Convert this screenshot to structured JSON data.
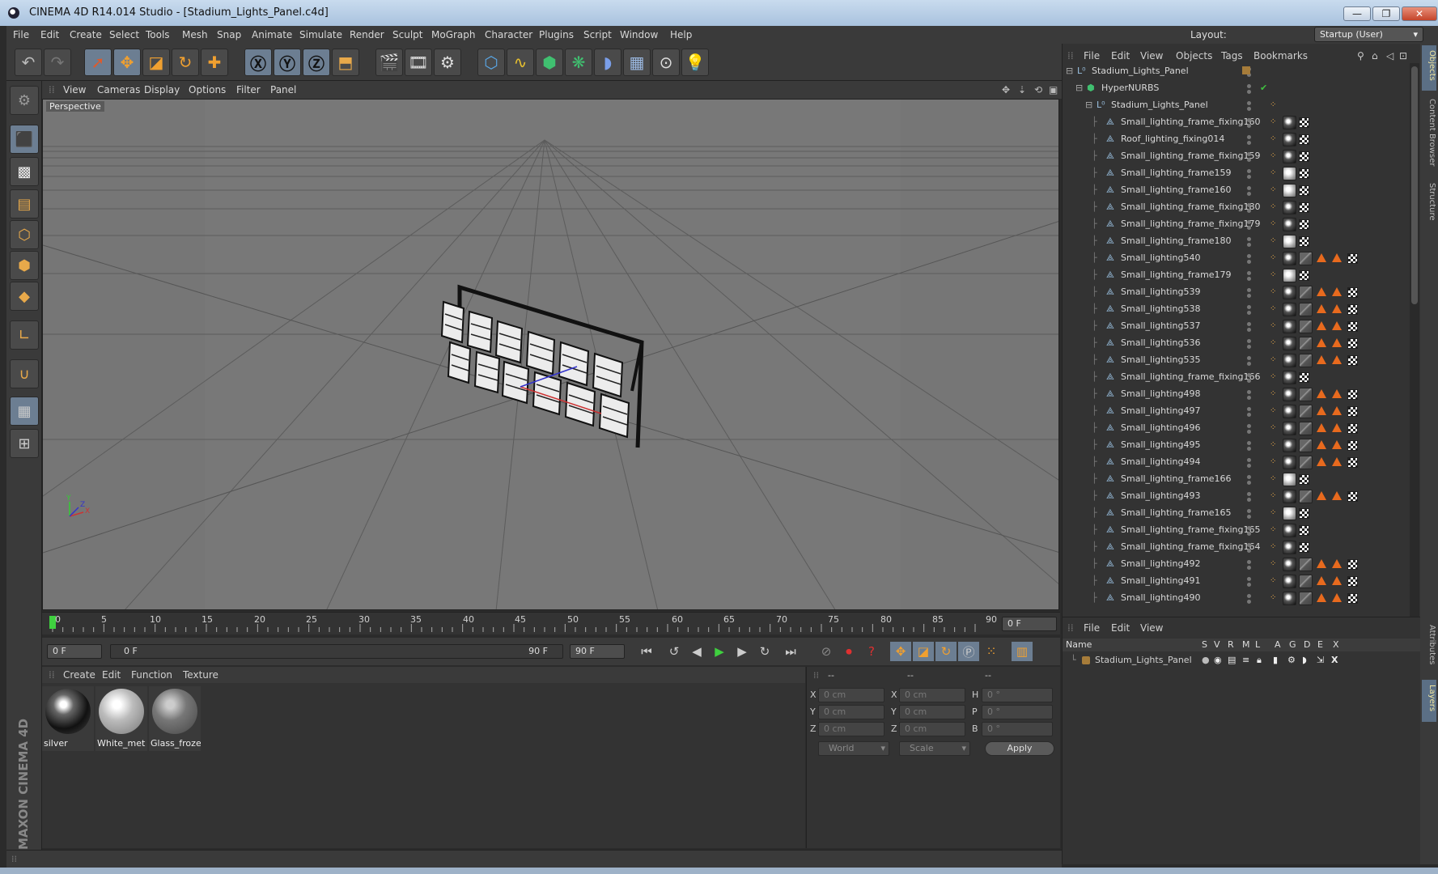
{
  "window": {
    "title": "CINEMA 4D R14.014 Studio - [Stadium_Lights_Panel.c4d]",
    "buttons": [
      "—",
      "❐",
      "✕"
    ]
  },
  "menubar": {
    "items": [
      "File",
      "Edit",
      "Create",
      "Select",
      "Tools",
      "Mesh",
      "Snap",
      "Animate",
      "Simulate",
      "Render",
      "Sculpt",
      "MoGraph",
      "Character",
      "Plugins",
      "Script",
      "Window",
      "Help"
    ],
    "layout_label": "Layout:",
    "layout_value": "Startup (User)"
  },
  "viewport": {
    "menu": [
      "View",
      "Cameras",
      "Display",
      "Options",
      "Filter",
      "Panel"
    ],
    "camera_label": "Perspective"
  },
  "timeline": {
    "ticks": [
      "0",
      "5",
      "10",
      "15",
      "20",
      "25",
      "30",
      "35",
      "40",
      "45",
      "50",
      "55",
      "60",
      "65",
      "70",
      "75",
      "80",
      "85",
      "90"
    ],
    "current_frame": "0 F"
  },
  "transport": {
    "start_field": "0 F",
    "range_start": "0 F",
    "range_end": "90 F",
    "end_field": "90 F"
  },
  "materials": {
    "menu": [
      "Create",
      "Edit",
      "Function",
      "Texture"
    ],
    "items": [
      {
        "name": "silver",
        "kind": "chrome"
      },
      {
        "name": "White_met",
        "kind": "white"
      },
      {
        "name": "Glass_froze",
        "kind": "glass"
      }
    ]
  },
  "coordinates": {
    "headers": [
      "--",
      "--",
      "--"
    ],
    "rows": [
      {
        "a": "X",
        "av": "0 cm",
        "b": "X",
        "bv": "0 cm",
        "c": "H",
        "cv": "0 °"
      },
      {
        "a": "Y",
        "av": "0 cm",
        "b": "Y",
        "bv": "0 cm",
        "c": "P",
        "cv": "0 °"
      },
      {
        "a": "Z",
        "av": "0 cm",
        "b": "Z",
        "bv": "0 cm",
        "c": "B",
        "cv": "0 °"
      }
    ],
    "mode": "World",
    "transform": "Scale",
    "apply": "Apply"
  },
  "objects": {
    "menu": [
      "File",
      "Edit",
      "View",
      "Objects",
      "Tags",
      "Bookmarks"
    ],
    "tree": [
      {
        "name": "Stadium_Lights_Panel",
        "level": 0,
        "type": "null",
        "tags": "root"
      },
      {
        "name": "HyperNURBS",
        "level": 1,
        "type": "hn",
        "tags": "hn"
      },
      {
        "name": "Stadium_Lights_Panel",
        "level": 2,
        "type": "null",
        "tags": "null"
      },
      {
        "name": "Small_lighting_frame_fixing160",
        "level": 3,
        "type": "poly",
        "tags": "mc"
      },
      {
        "name": "Roof_lighting_fixing014",
        "level": 3,
        "type": "poly",
        "tags": "mc"
      },
      {
        "name": "Small_lighting_frame_fixing159",
        "level": 3,
        "type": "poly",
        "tags": "mc"
      },
      {
        "name": "Small_lighting_frame159",
        "level": 3,
        "type": "poly",
        "tags": "wc"
      },
      {
        "name": "Small_lighting_frame160",
        "level": 3,
        "type": "poly",
        "tags": "wc"
      },
      {
        "name": "Small_lighting_frame_fixing180",
        "level": 3,
        "type": "poly",
        "tags": "mc"
      },
      {
        "name": "Small_lighting_frame_fixing179",
        "level": 3,
        "type": "poly",
        "tags": "mc"
      },
      {
        "name": "Small_lighting_frame180",
        "level": 3,
        "type": "poly",
        "tags": "wc"
      },
      {
        "name": "Small_lighting540",
        "level": 3,
        "type": "poly",
        "tags": "full"
      },
      {
        "name": "Small_lighting_frame179",
        "level": 3,
        "type": "poly",
        "tags": "wc"
      },
      {
        "name": "Small_lighting539",
        "level": 3,
        "type": "poly",
        "tags": "full"
      },
      {
        "name": "Small_lighting538",
        "level": 3,
        "type": "poly",
        "tags": "full"
      },
      {
        "name": "Small_lighting537",
        "level": 3,
        "type": "poly",
        "tags": "full"
      },
      {
        "name": "Small_lighting536",
        "level": 3,
        "type": "poly",
        "tags": "full"
      },
      {
        "name": "Small_lighting535",
        "level": 3,
        "type": "poly",
        "tags": "full"
      },
      {
        "name": "Small_lighting_frame_fixing166",
        "level": 3,
        "type": "poly",
        "tags": "mc"
      },
      {
        "name": "Small_lighting498",
        "level": 3,
        "type": "poly",
        "tags": "full"
      },
      {
        "name": "Small_lighting497",
        "level": 3,
        "type": "poly",
        "tags": "full"
      },
      {
        "name": "Small_lighting496",
        "level": 3,
        "type": "poly",
        "tags": "full"
      },
      {
        "name": "Small_lighting495",
        "level": 3,
        "type": "poly",
        "tags": "full"
      },
      {
        "name": "Small_lighting494",
        "level": 3,
        "type": "poly",
        "tags": "full"
      },
      {
        "name": "Small_lighting_frame166",
        "level": 3,
        "type": "poly",
        "tags": "wc"
      },
      {
        "name": "Small_lighting493",
        "level": 3,
        "type": "poly",
        "tags": "full"
      },
      {
        "name": "Small_lighting_frame165",
        "level": 3,
        "type": "poly",
        "tags": "wc"
      },
      {
        "name": "Small_lighting_frame_fixing165",
        "level": 3,
        "type": "poly",
        "tags": "mc"
      },
      {
        "name": "Small_lighting_frame_fixing164",
        "level": 3,
        "type": "poly",
        "tags": "mc"
      },
      {
        "name": "Small_lighting492",
        "level": 3,
        "type": "poly",
        "tags": "full"
      },
      {
        "name": "Small_lighting491",
        "level": 3,
        "type": "poly",
        "tags": "full"
      },
      {
        "name": "Small_lighting490",
        "level": 3,
        "type": "poly",
        "tags": "full"
      }
    ]
  },
  "layers": {
    "menu": [
      "File",
      "Edit",
      "View"
    ],
    "columns": [
      "Name",
      "S",
      "V",
      "R",
      "M",
      "L",
      "A",
      "G",
      "D",
      "E",
      "X"
    ],
    "rows": [
      {
        "name": "Stadium_Lights_Panel"
      }
    ]
  },
  "sidetabs": [
    "Objects",
    "Content Browser",
    "Structure",
    "Attributes",
    "Layers"
  ],
  "branding": "MAXON CINEMA 4D",
  "colors": {
    "accent": "#e8a94a",
    "active_tool": "#6c7e92",
    "viewport_bg": "#737373",
    "play_green": "#3fd03f"
  }
}
